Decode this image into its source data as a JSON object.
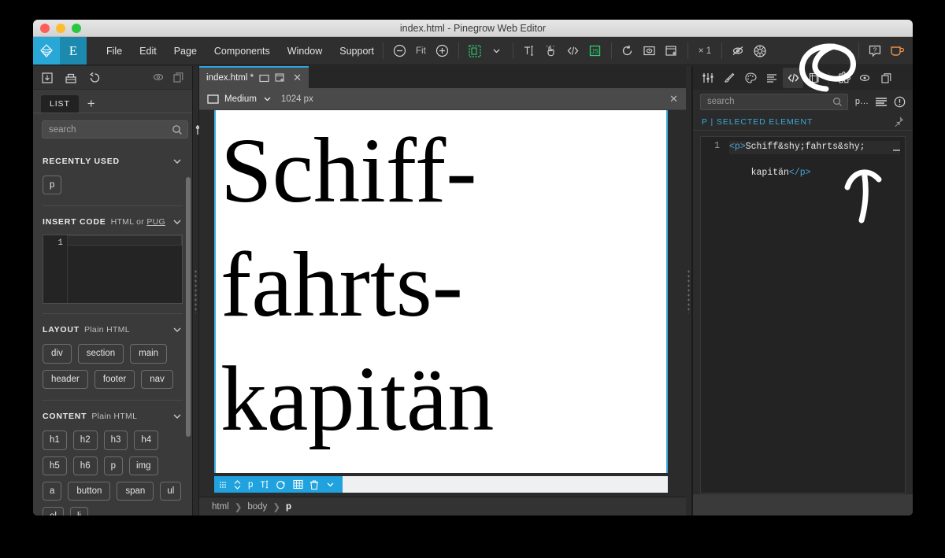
{
  "window": {
    "title": "index.html - Pinegrow Web Editor",
    "traffic_lights": [
      "close",
      "minimize",
      "zoom"
    ]
  },
  "menubar": {
    "logo_name": "pinegrow-logo",
    "brand_letter": "E",
    "items": [
      "File",
      "Edit",
      "Page",
      "Components",
      "Window",
      "Support"
    ],
    "zoom_out_icon": "minus-circle-icon",
    "zoom_label": "Fit",
    "zoom_in_icon": "plus-circle-icon",
    "device_icon": "device-frame-icon",
    "device_chevron": "chevron-down-icon",
    "text_icon": "text-edit-icon",
    "hand_icon": "hand-click-icon",
    "code_icon": "code-brackets-icon",
    "js_icon": "js-badge-icon",
    "reload_icon": "reload-icon",
    "preview_icon": "preview-eye-icon",
    "new_window_icon": "open-in-window-icon",
    "multiplier_label": "× 1",
    "hide_icon": "eye-slash-icon",
    "compass_icon": "compass-icon",
    "help_icon": "help-question-icon",
    "coffee_icon": "coffee-cup-icon"
  },
  "sidebar": {
    "top_icons": [
      "import-icon",
      "box-icon",
      "undo-icon"
    ],
    "top_right_icons": [
      "eye-icon",
      "duplicate-icon"
    ],
    "tab_label": "LIST",
    "add_tab_label": "+",
    "search": {
      "placeholder": "search",
      "value": "",
      "icon": "search-icon"
    },
    "filter_icon": "filter-tools-icon",
    "sections": [
      {
        "title": "RECENTLY USED",
        "subtitle": "",
        "chevron": "chevron-down-icon",
        "chips": [
          "p"
        ]
      },
      {
        "title": "INSERT CODE",
        "subtitle": "HTML or ",
        "subtitle_link": "PUG",
        "chevron": "chevron-down-icon",
        "code_line_number": "1",
        "code_value": ""
      },
      {
        "title": "LAYOUT",
        "subtitle": "Plain HTML",
        "chevron": "chevron-down-icon",
        "chips": [
          "div",
          "section",
          "main",
          "header",
          "footer",
          "nav"
        ]
      },
      {
        "title": "CONTENT",
        "subtitle": "Plain HTML",
        "chevron": "chevron-down-icon",
        "chips": [
          "h1",
          "h2",
          "h3",
          "h4",
          "h5",
          "h6",
          "p",
          "img",
          "a",
          "button",
          "span",
          "ul",
          "ol",
          "li"
        ]
      }
    ]
  },
  "center": {
    "document_tab": {
      "label": "index.html *",
      "window_icon": "window-icon",
      "detach_icon": "detach-window-icon",
      "close_icon": "close-icon"
    },
    "viewbar": {
      "device_icon": "screen-icon",
      "device_label": "Medium",
      "chevron": "chevron-down-icon",
      "width_label": "1024 px",
      "close_icon": "close-icon"
    },
    "page_content": "Schiff-\nfahrts-\nkapitän",
    "element_toolbar": {
      "drag_icon": "drag-handle-icon",
      "move_icon": "move-updown-icon",
      "tag_label": "p",
      "text_icon": "text-edit-icon",
      "add_icon": "add-circle-icon",
      "grid_icon": "grid-icon",
      "delete_icon": "trash-icon",
      "more_icon": "chevron-down-icon"
    },
    "breadcrumb": [
      "html",
      "body",
      "p"
    ]
  },
  "right_panel": {
    "tools": [
      {
        "name": "sliders-icon",
        "active": false
      },
      {
        "name": "brush-icon",
        "active": false
      },
      {
        "name": "palette-icon",
        "active": false
      },
      {
        "name": "text-lines-icon",
        "active": false
      },
      {
        "name": "code-brackets-icon",
        "active": true
      },
      {
        "name": "library-icon",
        "active": false
      },
      {
        "name": "puzzle-icon",
        "active": false
      },
      {
        "name": "eye-icon",
        "active": false
      },
      {
        "name": "duplicate-icon",
        "active": false
      }
    ],
    "search": {
      "placeholder": "search",
      "value": "",
      "icon": "search-icon"
    },
    "mini_label": "p…",
    "lines_icon": "lines-icon",
    "warning_icon": "exclamation-circle-icon",
    "selected_header": "P | SELECTED ELEMENT",
    "pin_icon": "pin-icon",
    "code": {
      "line_number": "1",
      "open_tag": "<p>",
      "text_part_1": "Schiff&shy;fahrts&shy;",
      "text_part_2": "kapitän",
      "close_tag": "</p>"
    }
  },
  "annotations": {
    "circle_target": "code-panel-button",
    "arrow_target": "selected-element-code"
  },
  "colors": {
    "accent_blue": "#29a8d8",
    "brand_teal": "#1b8aae",
    "selection_blue": "#1fa2dd",
    "panel_dark": "#2b2b2b",
    "sidebar_gray": "#3a3a3a",
    "code_green": "#2ecc71",
    "coffee_orange": "#e8944a",
    "annotation_white": "#ffffff"
  }
}
